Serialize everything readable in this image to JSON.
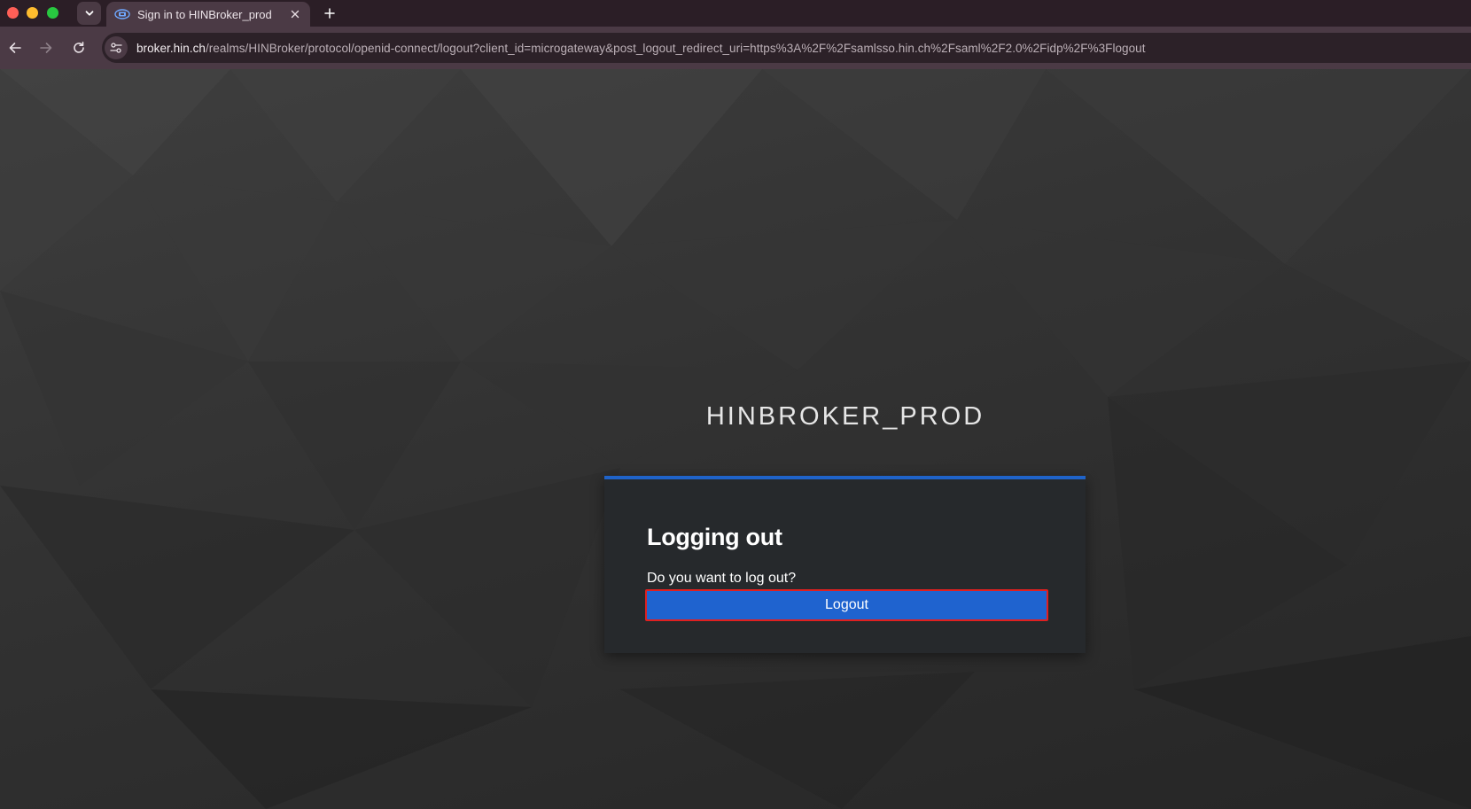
{
  "browser": {
    "tab": {
      "title": "Sign in to HINBroker_prod",
      "favicon": "hin-favicon"
    },
    "url": {
      "host": "broker.hin.ch",
      "path": "/realms/HINBroker/protocol/openid-connect/logout?client_id=microgateway&post_logout_redirect_uri=https%3A%2F%2Fsamlsso.hin.ch%2Fsaml%2F2.0%2Fidp%2F%3Flogout"
    },
    "icons": {
      "tab_list": "chevron-down-icon",
      "close": "close-icon",
      "new_tab": "plus-icon",
      "back": "arrow-left-icon",
      "forward": "arrow-right-icon",
      "reload": "reload-icon",
      "site_info": "tune-icon"
    }
  },
  "page": {
    "realm_title": "HINBROKER_PROD",
    "card": {
      "heading": "Logging out",
      "question": "Do you want to log out?",
      "logout_button": "Logout"
    }
  },
  "colors": {
    "accent": "#1f63c9",
    "highlight_border": "#e02020",
    "card_bg": "#26292c"
  }
}
